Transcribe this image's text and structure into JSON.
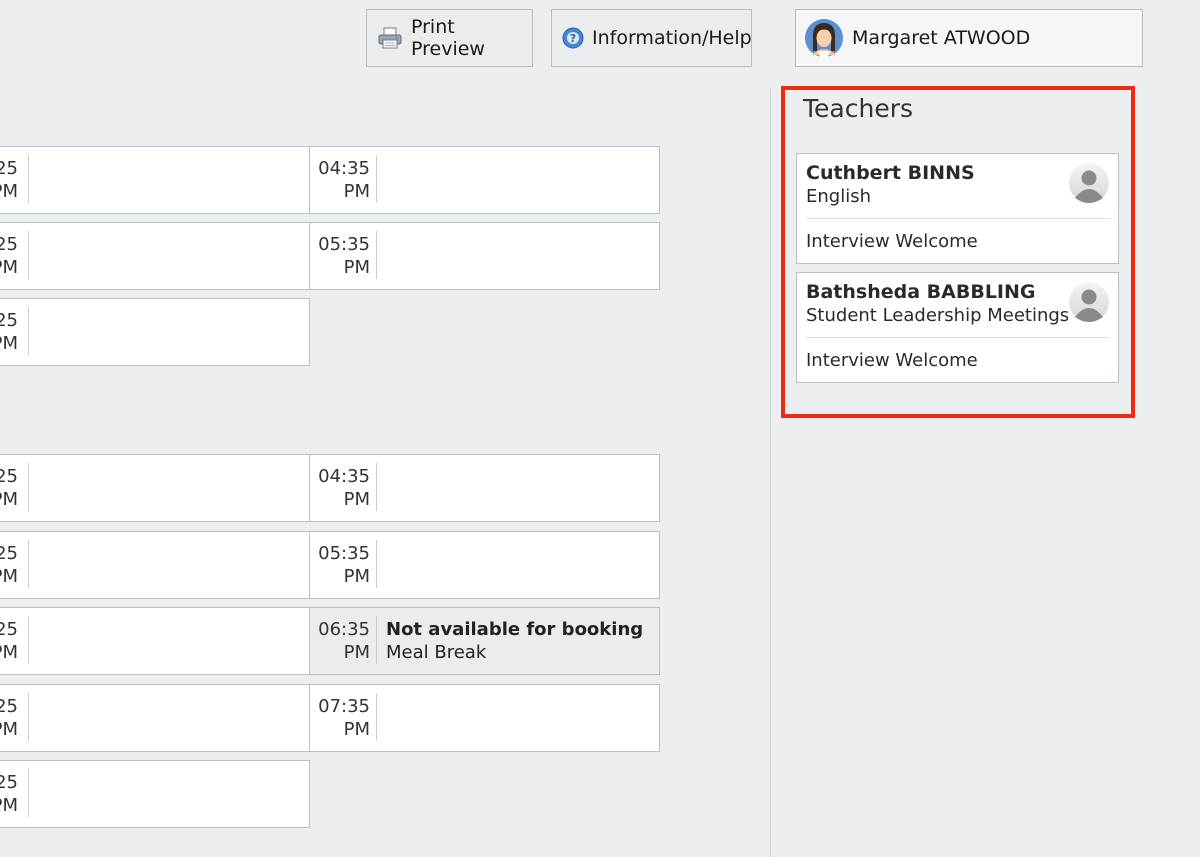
{
  "toolbar": {
    "print_preview": "Print Preview",
    "info_help": "Information/Help",
    "user_name": "Margaret ATWOOD"
  },
  "schedule": {
    "left_column": [
      {
        "time_top": "25",
        "time_bottom": "PM"
      },
      {
        "time_top": "25",
        "time_bottom": "PM"
      },
      {
        "time_top": "25",
        "time_bottom": "PM"
      },
      {
        "time_top": "25",
        "time_bottom": "PM"
      },
      {
        "time_top": "25",
        "time_bottom": "PM"
      },
      {
        "time_top": "25",
        "time_bottom": "PM"
      },
      {
        "time_top": "25",
        "time_bottom": "PM"
      },
      {
        "time_top": "25",
        "time_bottom": "PM"
      }
    ],
    "right_column": [
      {
        "time_top": "04:35",
        "time_bottom": "PM",
        "title": "",
        "subtitle": ""
      },
      {
        "time_top": "05:35",
        "time_bottom": "PM",
        "title": "",
        "subtitle": ""
      },
      {
        "time_top": "04:35",
        "time_bottom": "PM",
        "title": "",
        "subtitle": ""
      },
      {
        "time_top": "05:35",
        "time_bottom": "PM",
        "title": "",
        "subtitle": ""
      },
      {
        "time_top": "06:35",
        "time_bottom": "PM",
        "title": "Not available for booking",
        "subtitle": "Meal Break"
      },
      {
        "time_top": "07:35",
        "time_bottom": "PM",
        "title": "",
        "subtitle": ""
      }
    ]
  },
  "teachers_panel": {
    "title": "Teachers",
    "teachers": [
      {
        "name": "Cuthbert BINNS",
        "subject": "English",
        "link": "Interview Welcome"
      },
      {
        "name": "Bathsheda BABBLING",
        "subject": "Student Leadership Meetings",
        "link": "Interview Welcome"
      }
    ]
  },
  "colors": {
    "highlight_border": "#ef2a12",
    "background": "#edeef0"
  }
}
